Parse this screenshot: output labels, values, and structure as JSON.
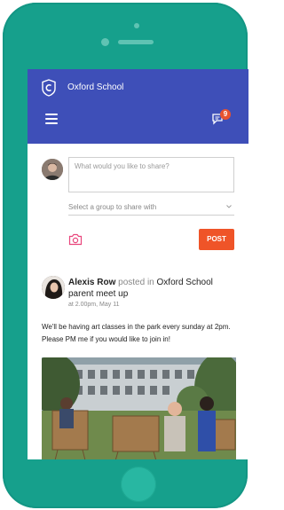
{
  "app": {
    "school_name": "Oxford School",
    "notification_count": "9",
    "accent_color": "#3e4fb8",
    "device_color": "#16a08c",
    "post_button_color": "#ef5428"
  },
  "composer": {
    "placeholder": "What would you like to share?",
    "group_select_placeholder": "Select a group to share with",
    "post_label": "POST"
  },
  "post": {
    "author": "Alexis Row",
    "connector": "posted in",
    "group": "Oxford School parent meet up",
    "time": "at 2.00pm, May 11",
    "body": "We'll be having art classes in the park every sunday at 2pm. Please PM me if you would like to join in!"
  },
  "icons": [
    "logo-c-shield-icon",
    "menu-icon",
    "chat-icon",
    "camera-icon",
    "chevron-down-icon"
  ]
}
